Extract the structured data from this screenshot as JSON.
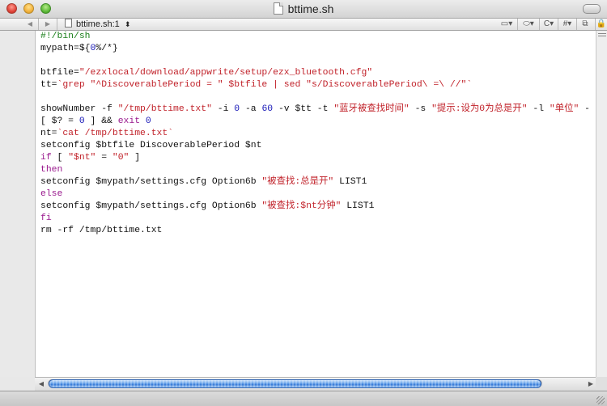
{
  "window": {
    "title": "bttime.sh"
  },
  "navbar": {
    "back_glyph": "◀",
    "forward_glyph": "▶",
    "file_popup": "bttime.sh:1",
    "file_popup_arrows": "⬍",
    "tools": [
      {
        "name": "bookmark-menu",
        "glyph": "▭▾"
      },
      {
        "name": "tag-menu",
        "glyph": "⬭▾"
      },
      {
        "name": "function-menu",
        "glyph": "C▾"
      },
      {
        "name": "pound-menu",
        "glyph": "#▾"
      },
      {
        "name": "split-view",
        "glyph": "⧉"
      }
    ],
    "lock_glyph": "🔒"
  },
  "editor": {
    "lines": [
      {
        "segs": [
          {
            "t": "#!/bin/sh",
            "c": "comment"
          }
        ]
      },
      {
        "segs": [
          {
            "t": "mypath=${"
          },
          {
            "t": "0",
            "c": "num"
          },
          {
            "t": "%/*}"
          }
        ]
      },
      {
        "segs": []
      },
      {
        "segs": [
          {
            "t": "btfile="
          },
          {
            "t": "\"/ezxlocal/download/appwrite/setup/ezx_bluetooth.cfg\"",
            "c": "str"
          }
        ]
      },
      {
        "segs": [
          {
            "t": "tt="
          },
          {
            "t": "`grep \"^DiscoverablePeriod = \" $btfile | sed \"s/DiscoverablePeriod\\ =\\ //\"`",
            "c": "str"
          }
        ]
      },
      {
        "segs": []
      },
      {
        "segs": [
          {
            "t": "showNumber -f "
          },
          {
            "t": "\"/tmp/bttime.txt\"",
            "c": "str"
          },
          {
            "t": " -i "
          },
          {
            "t": "0",
            "c": "num"
          },
          {
            "t": " -a "
          },
          {
            "t": "60",
            "c": "num"
          },
          {
            "t": " -v $tt -t "
          },
          {
            "t": "\"蓝牙被查找时间\"",
            "c": "str"
          },
          {
            "t": " -s "
          },
          {
            "t": "\"提示:设为0为总是开\"",
            "c": "str"
          },
          {
            "t": " -l "
          },
          {
            "t": "\"单位\"",
            "c": "str"
          },
          {
            "t": " -"
          }
        ]
      },
      {
        "segs": [
          {
            "t": "[ $? = "
          },
          {
            "t": "0",
            "c": "num"
          },
          {
            "t": " ] && "
          },
          {
            "t": "exit",
            "c": "kw"
          },
          {
            "t": " "
          },
          {
            "t": "0",
            "c": "num"
          }
        ]
      },
      {
        "segs": [
          {
            "t": "nt="
          },
          {
            "t": "`cat /tmp/bttime.txt`",
            "c": "str"
          }
        ]
      },
      {
        "segs": [
          {
            "t": "setconfig $btfile DiscoverablePeriod $nt"
          }
        ]
      },
      {
        "segs": [
          {
            "t": "if",
            "c": "kw"
          },
          {
            "t": " [ "
          },
          {
            "t": "\"$nt\"",
            "c": "str"
          },
          {
            "t": " = "
          },
          {
            "t": "\"0\"",
            "c": "str"
          },
          {
            "t": " ]"
          }
        ]
      },
      {
        "segs": [
          {
            "t": "then",
            "c": "kw"
          }
        ]
      },
      {
        "segs": [
          {
            "t": "setconfig $mypath/settings.cfg Option6b "
          },
          {
            "t": "\"被查找:总是开\"",
            "c": "str"
          },
          {
            "t": " LIST1"
          }
        ]
      },
      {
        "segs": [
          {
            "t": "else",
            "c": "kw"
          }
        ]
      },
      {
        "segs": [
          {
            "t": "setconfig $mypath/settings.cfg Option6b "
          },
          {
            "t": "\"被查找:$nt分钟\"",
            "c": "str"
          },
          {
            "t": " LIST1"
          }
        ]
      },
      {
        "segs": [
          {
            "t": "fi",
            "c": "kw"
          }
        ]
      },
      {
        "segs": [
          {
            "t": "rm -rf /tmp/bttime.txt"
          }
        ]
      }
    ]
  },
  "hscroll": {
    "left_glyph": "◀",
    "right_glyph": "▶",
    "thumb_fraction": 1.0
  },
  "colors": {
    "comment": "#1a7f1a",
    "string": "#c1222a",
    "keyword": "#9a1a8e",
    "number": "#1a1ab8"
  }
}
